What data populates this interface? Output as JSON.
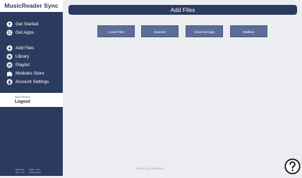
{
  "app": {
    "title": "MusicReader Sync"
  },
  "sidebar": {
    "items": [
      {
        "label": "Get Started",
        "icon": "bulb-icon"
      },
      {
        "label": "Get Apps",
        "icon": "apps-icon"
      },
      {
        "label": "Add Files",
        "icon": "add-files-icon"
      },
      {
        "label": "Library",
        "icon": "library-icon"
      },
      {
        "label": "Playlist",
        "icon": "playlist-icon"
      },
      {
        "label": "Modules Store",
        "icon": "puzzle-icon"
      },
      {
        "label": "Account Settings",
        "icon": "user-gear-icon"
      }
    ],
    "account": {
      "label": "App Review",
      "logout": "Logout"
    },
    "footer": {
      "left_line1": "Beta (Alt)",
      "left_line2": "Sync - Pro",
      "right_line1": "Alpha - 4.0.0",
      "right_line2": "Privacy Policy"
    }
  },
  "header": {
    "title": "Add Files"
  },
  "actions": [
    {
      "label": "Local Files"
    },
    {
      "label": "Scanner"
    },
    {
      "label": "Cloud Storage"
    },
    {
      "label": "Mailbox"
    }
  ],
  "footer": {
    "server_label": "DEVELOP SERVER"
  },
  "help": {
    "icon": "question-circle-icon"
  },
  "colors": {
    "navy": "#2a3b5f",
    "button": "#5c6e97",
    "background": "#ecedf0"
  }
}
